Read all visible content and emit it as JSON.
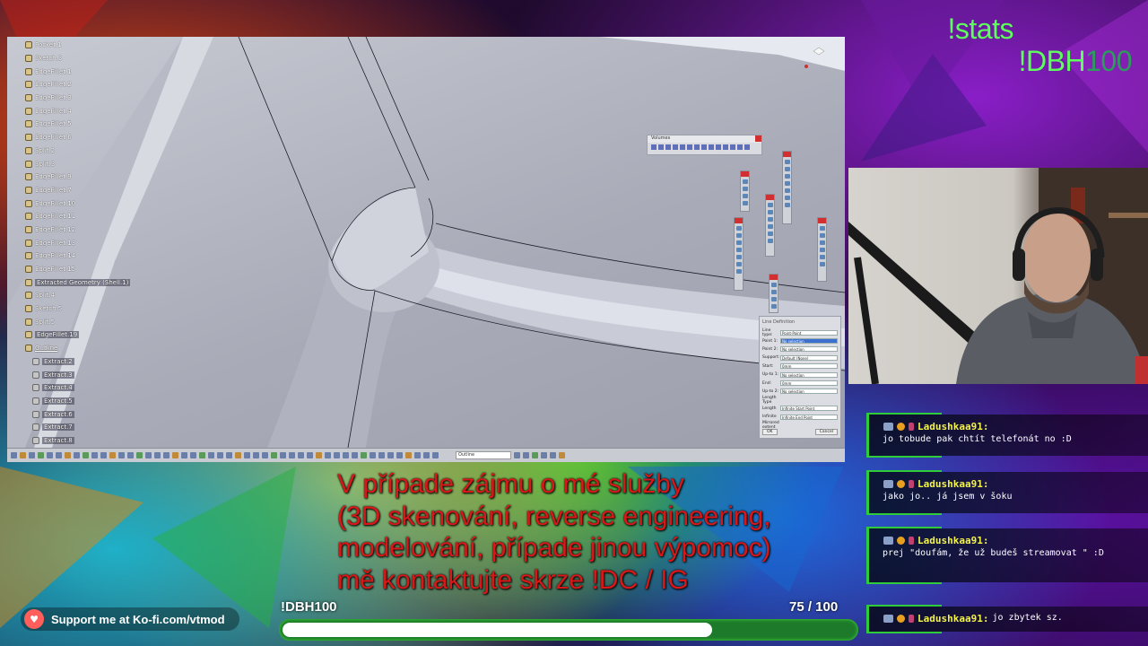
{
  "overlay": {
    "stats_cmd": "!stats",
    "dbh_cmd_prefix": "!DBH",
    "dbh_cmd_suffix": "100"
  },
  "cad": {
    "tree_items": [
      {
        "label": "Pocket.1",
        "type": "feature"
      },
      {
        "label": "Sketch.3",
        "type": "sketch"
      },
      {
        "label": "EdgeFillet.1",
        "type": "feature"
      },
      {
        "label": "EdgeFillet.2",
        "type": "feature"
      },
      {
        "label": "EdgeFillet.3",
        "type": "feature"
      },
      {
        "label": "EdgeFillet.4",
        "type": "feature"
      },
      {
        "label": "EdgeFillet.5",
        "type": "feature"
      },
      {
        "label": "EdgeFillet.6",
        "type": "feature"
      },
      {
        "label": "Split.2",
        "type": "feature"
      },
      {
        "label": "Split.3",
        "type": "feature"
      },
      {
        "label": "EdgeFillet.9",
        "type": "feature"
      },
      {
        "label": "EdgeFillet.7",
        "type": "feature"
      },
      {
        "label": "EdgeFillet.10",
        "type": "feature"
      },
      {
        "label": "EdgeFillet.11",
        "type": "feature"
      },
      {
        "label": "EdgeFillet.12",
        "type": "feature"
      },
      {
        "label": "EdgeFillet.13",
        "type": "feature"
      },
      {
        "label": "EdgeFillet.14",
        "type": "feature"
      },
      {
        "label": "EdgeFillet.15",
        "type": "feature"
      },
      {
        "label": "Extracted Geometry (Shell.1)",
        "type": "feature",
        "highlight": true
      },
      {
        "label": "Split.4",
        "type": "feature"
      },
      {
        "label": "Sketch.5",
        "type": "sketch"
      },
      {
        "label": "Split.5",
        "type": "feature"
      },
      {
        "label": "EdgeFillet.19",
        "type": "feature",
        "highlight": true
      },
      {
        "label": "Outline",
        "type": "group"
      },
      {
        "label": "Extract.2",
        "type": "sub",
        "highlight": true
      },
      {
        "label": "Extract.3",
        "type": "sub",
        "highlight": true
      },
      {
        "label": "Extract.4",
        "type": "sub",
        "highlight": true
      },
      {
        "label": "Extract.5",
        "type": "sub",
        "highlight": true
      },
      {
        "label": "Extract.6",
        "type": "sub",
        "highlight": true
      },
      {
        "label": "Extract.7",
        "type": "sub",
        "highlight": true
      },
      {
        "label": "Extract.8",
        "type": "sub",
        "highlight": true
      }
    ],
    "fav_toolbar_title": "Volumes",
    "line_dialog": {
      "title": "Line Definition",
      "fields": [
        {
          "key": "Line type:",
          "value": "Point-Point"
        },
        {
          "key": "Point 1:",
          "value": "No selection",
          "selected": true
        },
        {
          "key": "Point 2:",
          "value": "No selection"
        },
        {
          "key": "Support:",
          "value": "Default (None)"
        },
        {
          "key": "Start:",
          "value": "0mm"
        },
        {
          "key": "Up-to 1:",
          "value": "No selection"
        },
        {
          "key": "End:",
          "value": "0mm"
        },
        {
          "key": "Up-to 2:",
          "value": "No selection"
        },
        {
          "key": "Length Type",
          "value": ""
        },
        {
          "key": "Length",
          "value": "Infinite Start Point"
        },
        {
          "key": "Infinite",
          "value": "Infinite End Point"
        },
        {
          "key": "Mirrored extent",
          "value": ""
        }
      ],
      "ok_label": "OK",
      "cancel_label": "Cancel"
    },
    "status_field": "Outline"
  },
  "promo": {
    "line1": "V případe zájmu o mé služby",
    "line2": "(3D skenování, reverse engineering,",
    "line3": "modelování, případe jinou výpomoc)",
    "line4": "mě kontaktujte skrze !DC / IG"
  },
  "goal": {
    "label": "!DBH100",
    "count_text": "75  / 100",
    "current": 75,
    "target": 100
  },
  "kofi": {
    "label": "Support me at Ko-fi.com/vtmod"
  },
  "chat": {
    "messages": [
      {
        "user": "Ladushkaa91:",
        "text": "jo tobude pak chtít telefonát no :D",
        "inline": false
      },
      {
        "user": "Ladushkaa91:",
        "text": "jako jo.. já jsem v šoku",
        "inline": false
      },
      {
        "user": "Ladushkaa91:",
        "text": "prej \"doufám, že už budeš streamovat \" :D",
        "inline": false
      },
      {
        "user": "Ladushkaa91:",
        "text": "jo zbytek sz.",
        "inline": true
      }
    ]
  },
  "colors": {
    "accent_green": "#2ecb3a",
    "chat_user": "#f2f24a",
    "promo_red": "#d81818"
  }
}
